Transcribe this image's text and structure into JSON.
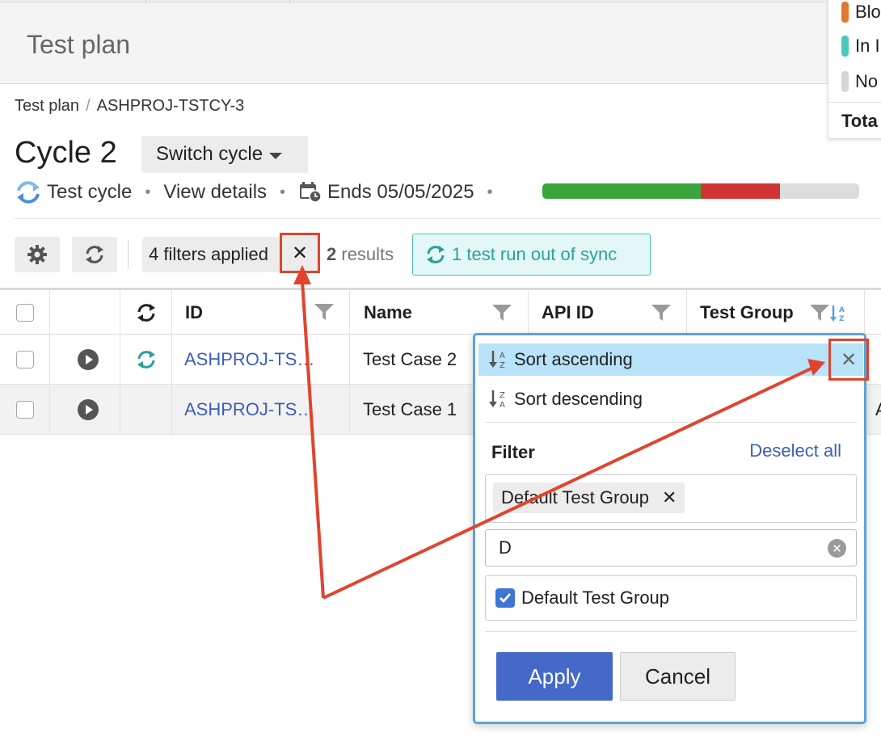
{
  "header": {
    "title": "Test plan"
  },
  "legend": {
    "items": [
      {
        "label": "Blo",
        "color": "#e07a2f"
      },
      {
        "label": "In I",
        "color": "#4bc7bd"
      },
      {
        "label": "No",
        "color": "#d6d6d6"
      }
    ],
    "total_label": "Tota"
  },
  "breadcrumb": {
    "root": "Test plan",
    "separator": "/",
    "current": "ASHPROJ-TSTCY-3"
  },
  "cycle": {
    "title": "Cycle 2",
    "switch_label": "Switch cycle",
    "type_label": "Test cycle",
    "view_details": "View details",
    "ends": "Ends 05/05/2025",
    "progress": {
      "pass_fraction": 0.5,
      "fail_fraction": 0.25,
      "pass_color": "#3aa53a",
      "fail_color": "#cf3434"
    }
  },
  "toolbar": {
    "filters_label": "4 filters applied",
    "clear_filters_glyph": "✕",
    "results_count": "2",
    "results_label": "results",
    "sync_label": "1 test run out of sync"
  },
  "table": {
    "columns": {
      "id": "ID",
      "name": "Name",
      "api_id": "API ID",
      "test_group": "Test Group"
    },
    "rows": [
      {
        "id": "ASHPROJ-TS…",
        "name": "Test Case 2",
        "out_of_sync": true
      },
      {
        "id": "ASHPROJ-TS…",
        "name": "Test Case 1",
        "out_of_sync": false,
        "next_col_text": "A"
      }
    ]
  },
  "popover": {
    "sort_ascending": "Sort ascending",
    "sort_descending": "Sort descending",
    "close_glyph": "✕",
    "filter_label": "Filter",
    "deselect_all": "Deselect all",
    "selected_tag": "Default Test Group",
    "search_value": "D",
    "option_label": "Default Test Group",
    "option_checked": true,
    "apply": "Apply",
    "cancel": "Cancel"
  }
}
